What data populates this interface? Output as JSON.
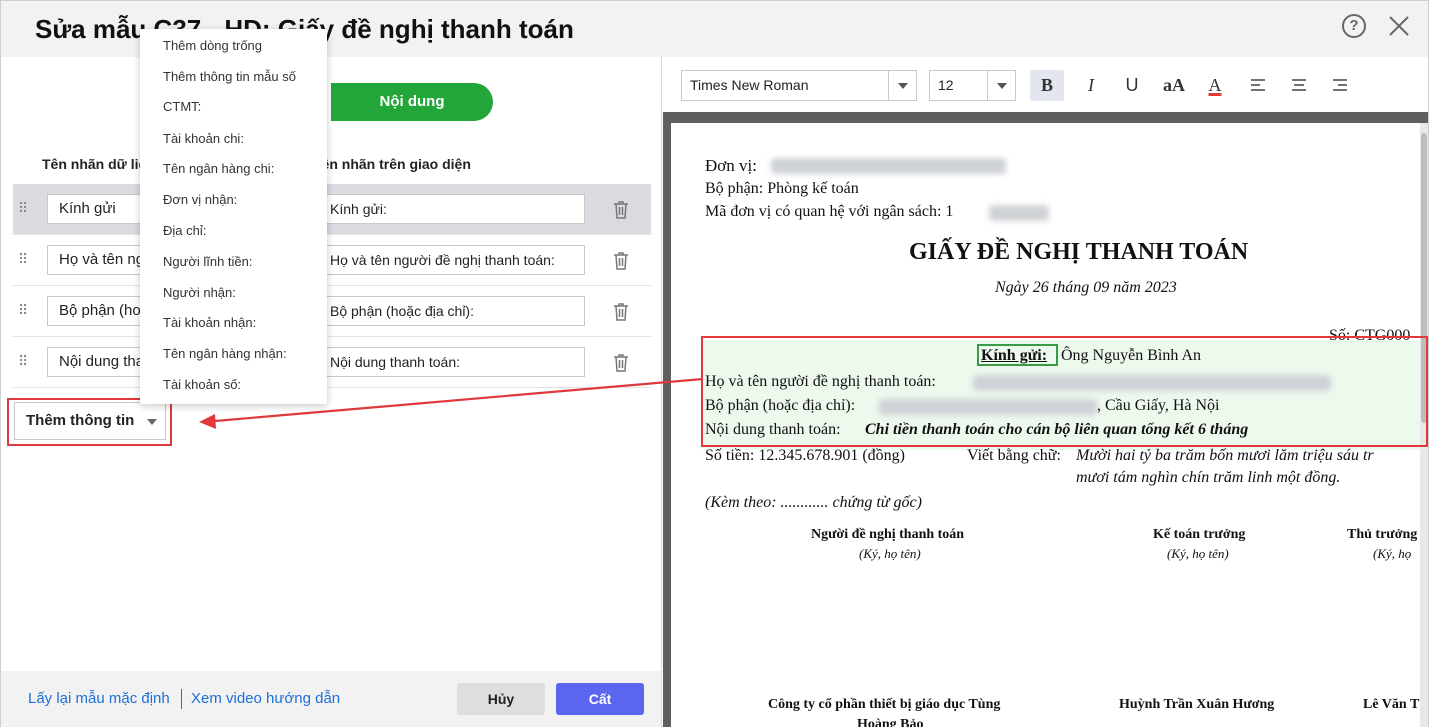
{
  "header": {
    "title": "Sửa mẫu C37 - HD: Giấy đề nghị thanh toán"
  },
  "tabs": {
    "content_label": "Nội dung"
  },
  "columns": {
    "data_label": "Tên nhãn dữ liệu",
    "ui_label": "Tên nhãn trên giao diện"
  },
  "rows": [
    {
      "data_label": "Kính gửi",
      "ui_label": "Kính gửi:"
    },
    {
      "data_label": "Họ và tên người đề nghị thanh toán",
      "ui_label": "Họ và tên người đề nghị thanh toán:"
    },
    {
      "data_label": "Bộ phận (hoặc địa chỉ)",
      "ui_label": "Bộ phận (hoặc địa chỉ):"
    },
    {
      "data_label": "Nội dung thanh toán",
      "ui_label": "Nội dung thanh toán:"
    }
  ],
  "add_button": {
    "label": "Thêm thông tin"
  },
  "menu": {
    "items": [
      "Thêm dòng trống",
      "Thêm thông tin mẫu số",
      "CTMT:",
      "Tài khoản chi:",
      "Tên ngân hàng chi:",
      "Đơn vị nhận:",
      "Địa chỉ:",
      "Người lĩnh tiền:",
      "Người nhận:",
      "Tài khoản nhận:",
      "Tên ngân hàng nhận:",
      "Tài khoản số:"
    ]
  },
  "footer": {
    "reset_link": "Lấy lại mẫu mặc định",
    "video_link": "Xem video hướng dẫn",
    "cancel_label": "Hủy",
    "cut_label": "Cất"
  },
  "toolbar": {
    "font": "Times New Roman",
    "size": "12",
    "bold": "B",
    "italic": "I",
    "underline": "U",
    "case": "aA",
    "color": "A",
    "text_color": "#e0393b"
  },
  "document": {
    "unit_label": "Đơn vị:",
    "dept_line": "Bộ phận: Phòng kế toán",
    "budget_code_label": "Mã đơn vị có quan hệ với ngân sách: 1",
    "title": "GIẤY ĐỀ NGHỊ THANH TOÁN",
    "date": "Ngày 26 tháng 09 năm 2023",
    "number": "Số: CTG000",
    "kinh_gui_label": "Kính gửi:",
    "kinh_gui_value": "Ông Nguyễn Bình An",
    "requester_label": "Họ và tên người đề nghị thanh toán:",
    "dept_label": "Bộ phận (hoặc địa chỉ):",
    "dept_value_tail": ", Cầu Giấy, Hà Nội",
    "content_label": "Nội dung thanh toán:",
    "content_value": "Chi tiền thanh toán cho cán bộ liên quan tổng kết 6 tháng",
    "amount": "Số tiền: 12.345.678.901 (đồng)",
    "words_label": "Viết bằng chữ:",
    "words_value_1": "Mười hai tỷ ba trăm bốn mươi lăm triệu sáu tr",
    "words_value_2": "mươi tám nghìn chín trăm linh một đồng.",
    "attached": "(Kèm theo: ............ chứng từ gốc)",
    "sig1_title": "Người đề nghị thanh toán",
    "sig1_sub": "(Ký, họ tên)",
    "sig2_title": "Kế toán trưởng",
    "sig2_sub": "(Ký, họ tên)",
    "sig3_title": "Thủ trưởng",
    "sig3_sub": "(Ký, họ",
    "sig1_name": "Công ty cổ phần thiết bị giáo dục Tùng",
    "sig1_name_2": "Hoàng Bảo",
    "sig2_name": "Huỳnh Trần Xuân Hương",
    "sig3_name": "Lê Văn T"
  }
}
